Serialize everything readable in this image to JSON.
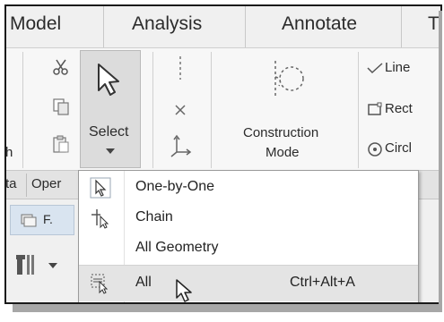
{
  "tabs": [
    "Model",
    "Analysis",
    "Annotate",
    "T"
  ],
  "ribbon": {
    "select_label": "Select",
    "construction_label_1": "Construction",
    "construction_label_2": "Mode",
    "sketch_tools": [
      "Line",
      "Rect",
      "Circl"
    ],
    "left_edge_char": "h"
  },
  "panel_labels": [
    "ta",
    "Oper"
  ],
  "lower_toolbar": {
    "folder_label": "F."
  },
  "dropdown": {
    "items": [
      {
        "label": "One-by-One",
        "shortcut": ""
      },
      {
        "label": "Chain",
        "shortcut": ""
      },
      {
        "label": "All Geometry",
        "shortcut": ""
      },
      {
        "label": "All",
        "shortcut": "Ctrl+Alt+A"
      }
    ],
    "highlighted_index": 3
  },
  "colors": {
    "ribbon_bg": "#f7f7f7",
    "tab_bg": "#f0f0f0",
    "highlight": "#e4e4e4",
    "pressed_button": "#dcdcdc"
  },
  "icons": [
    "scissors-icon",
    "copy-icon",
    "paste-icon",
    "cursor-icon",
    "dropdown-arrow-icon",
    "dashed-line-icon",
    "point-x-icon",
    "axis-icon",
    "construction-mode-icon",
    "line-icon",
    "rectangle-icon",
    "circle-icon",
    "folder-icon",
    "tools-icon",
    "mouse-pointer-icon"
  ]
}
